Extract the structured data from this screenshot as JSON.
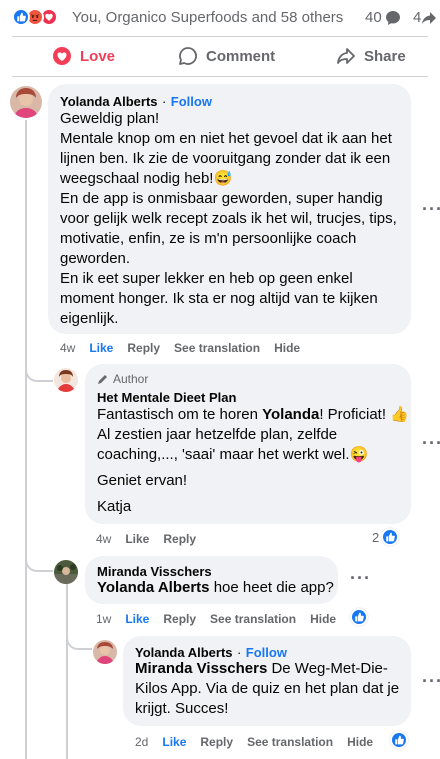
{
  "reactions": {
    "summary": "You, Organico Superfoods and 58 others",
    "comment_count": "40",
    "share_count": "4"
  },
  "actions": {
    "love": "Love",
    "comment": "Comment",
    "share": "Share"
  },
  "colors": {
    "brand_blue": "#1877f2",
    "love_red": "#f33e58",
    "bubble_bg": "#f0f2f5",
    "muted": "#65676b"
  },
  "comments": [
    {
      "author": "Yolanda Alberts",
      "follow": "Follow",
      "lines": [
        "Geweldig plan!",
        "Mentale knop om en niet het gevoel dat ik aan het",
        "lijnen ben. Ik zie de vooruitgang zonder dat ik een",
        "weegschaal nodig heb!😅",
        "En de app is onmisbaar geworden, super handig",
        "voor gelijk welk recept zoals ik het wil, trucjes, tips,",
        "motivatie, enfin, ze is m'n persoonlijke coach",
        "geworden.",
        "En ik eet super lekker en heb op geen enkel",
        "moment honger. Ik sta er nog altijd van te kijken",
        "eigenlijk."
      ],
      "time": "4w",
      "like": "Like",
      "reply": "Reply",
      "see_translation": "See translation",
      "hide": "Hide"
    },
    {
      "author_tag": "Author",
      "author": "Het Mentale Dieet Plan",
      "line1_pre": "Fantastisch om te horen ",
      "line1_name": "Yolanda",
      "line1_post": "! Proficiat! 👍",
      "line2": "Al zestien jaar hetzelfde plan, zelfde",
      "line3": "coaching,..., 'saai' maar het werkt wel.😜",
      "line4": "Geniet ervan!",
      "line5": "Katja",
      "time": "4w",
      "like": "Like",
      "reply": "Reply",
      "like_count": "2"
    },
    {
      "author": "Miranda Visschers",
      "mention": "Yolanda Alberts",
      "text": " hoe heet die app?",
      "time": "1w",
      "like": "Like",
      "reply": "Reply",
      "see_translation": "See translation",
      "hide": "Hide"
    },
    {
      "author": "Yolanda Alberts",
      "follow": "Follow",
      "mention": "Miranda Visschers",
      "line1_post": " De Weg-Met-Die-",
      "line2": "Kilos App. Via de quiz en het plan dat je",
      "line3": "krijgt. Succes!",
      "time": "2d",
      "like": "Like",
      "reply": "Reply",
      "see_translation": "See translation",
      "hide": "Hide"
    }
  ]
}
